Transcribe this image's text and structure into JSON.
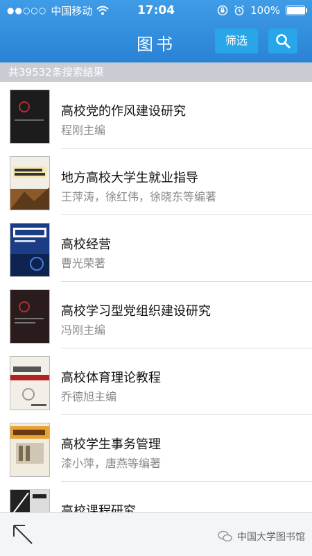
{
  "status_bar": {
    "carrier": "中国移动",
    "time": "17:04",
    "battery": "100%",
    "battery_level": 1.0
  },
  "nav": {
    "title": "图书",
    "filter_label": "筛选",
    "search_icon": "search-icon"
  },
  "result_count_text": "共39532条搜索结果",
  "books": [
    {
      "title": "高校党的作风建设研究",
      "author": "程刚主编",
      "cover_color": "#1c1c1c"
    },
    {
      "title": "地方高校大学生就业指导",
      "author": "王萍涛，徐红伟，徐晓东等编著",
      "cover_color": "#8b5a2b"
    },
    {
      "title": "高校经营",
      "author": "曹光荣著",
      "cover_color": "#1b3d86"
    },
    {
      "title": "高校学习型党组织建设研究",
      "author": "冯刚主编",
      "cover_color": "#2a1c1c"
    },
    {
      "title": "高校体育理论教程",
      "author": "乔德旭主编",
      "cover_color": "#f4efe6"
    },
    {
      "title": "高校学生事务管理",
      "author": "漆小萍，唐燕等编著",
      "cover_color": "#e8a232"
    },
    {
      "title": "高校课程研究",
      "author": "",
      "cover_color": "#222222"
    }
  ],
  "footer": {
    "back_icon": "arrow-up-left-icon",
    "watermark": "中国大学图书馆"
  },
  "colors": {
    "header": "#2f8ee0",
    "button": "#29a6e8",
    "result_bar": "#c9cdd3"
  }
}
